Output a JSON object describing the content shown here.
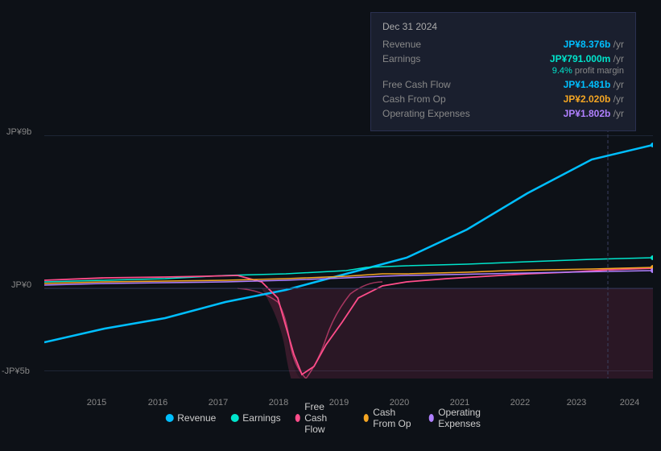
{
  "tooltip": {
    "title": "Dec 31 2024",
    "rows": [
      {
        "label": "Revenue",
        "value": "JP¥8.376b",
        "unit": "/yr",
        "color": "blue",
        "sub": null
      },
      {
        "label": "Earnings",
        "value": "JP¥791.000m",
        "unit": "/yr",
        "color": "teal",
        "sub": "9.4% profit margin"
      },
      {
        "label": "Free Cash Flow",
        "value": "JP¥1.481b",
        "unit": "/yr",
        "color": "blue",
        "sub": null
      },
      {
        "label": "Cash From Op",
        "value": "JP¥2.020b",
        "unit": "/yr",
        "color": "orange",
        "sub": null
      },
      {
        "label": "Operating Expenses",
        "value": "JP¥1.802b",
        "unit": "/yr",
        "color": "purple",
        "sub": null
      }
    ]
  },
  "yLabels": [
    {
      "value": "JP¥9b",
      "topPct": 28
    },
    {
      "value": "JP¥0",
      "topPct": 58
    },
    {
      "value": "-JP¥5b",
      "topPct": 84
    }
  ],
  "xLabels": [
    "2015",
    "2016",
    "2017",
    "2018",
    "2019",
    "2020",
    "2021",
    "2022",
    "2023",
    "2024"
  ],
  "legend": [
    {
      "label": "Revenue",
      "color": "#00bfff"
    },
    {
      "label": "Earnings",
      "color": "#00e5cc"
    },
    {
      "label": "Free Cash Flow",
      "color": "#ff4d8a"
    },
    {
      "label": "Cash From Op",
      "color": "#f5a623"
    },
    {
      "label": "Operating Expenses",
      "color": "#b080ff"
    }
  ]
}
